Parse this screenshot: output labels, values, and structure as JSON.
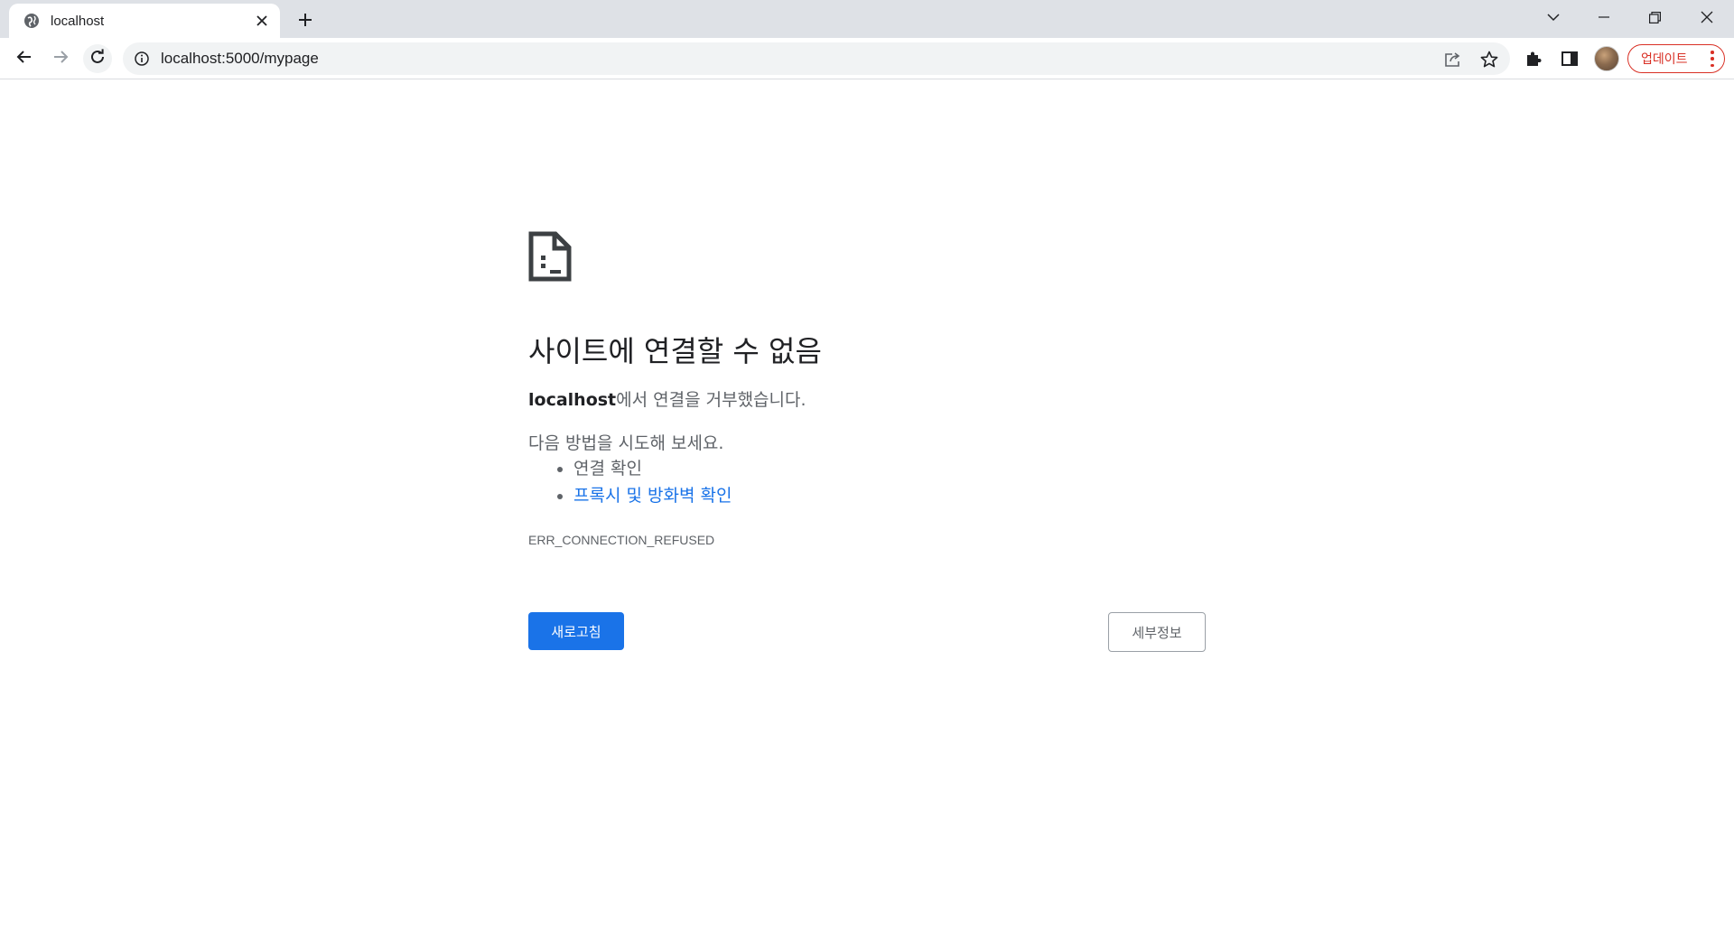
{
  "tab": {
    "title": "localhost",
    "favicon": "globe-icon",
    "close_icon": "close-icon",
    "new_tab_icon": "plus-icon"
  },
  "window_controls": [
    "tab-search-chevron-icon",
    "minimize-icon",
    "restore-icon",
    "close-icon"
  ],
  "toolbar": {
    "back_icon": "back-arrow-icon",
    "forward_icon": "forward-arrow-icon",
    "reload_icon": "reload-icon",
    "url": "localhost:5000/mypage",
    "info_icon": "info-icon",
    "share_icon": "share-icon",
    "bookmark_icon": "star-icon",
    "extensions_icon": "puzzle-icon",
    "side_panel_icon": "side-panel-icon",
    "update_label": "업데이트",
    "accent_color": "#d93025"
  },
  "error": {
    "icon": "sad-page-icon",
    "heading": "사이트에 연결할 수 없음",
    "host": "localhost",
    "summary_suffix": "에서 연결을 거부했습니다.",
    "try_label": "다음 방법을 시도해 보세요.",
    "suggestions": [
      "연결 확인",
      "프록시 및 방화벽 확인"
    ],
    "error_code": "ERR_CONNECTION_REFUSED",
    "reload_label": "새로고침",
    "details_label": "세부정보",
    "primary_color": "#1a73e8",
    "link_color": "#1a73e8"
  }
}
